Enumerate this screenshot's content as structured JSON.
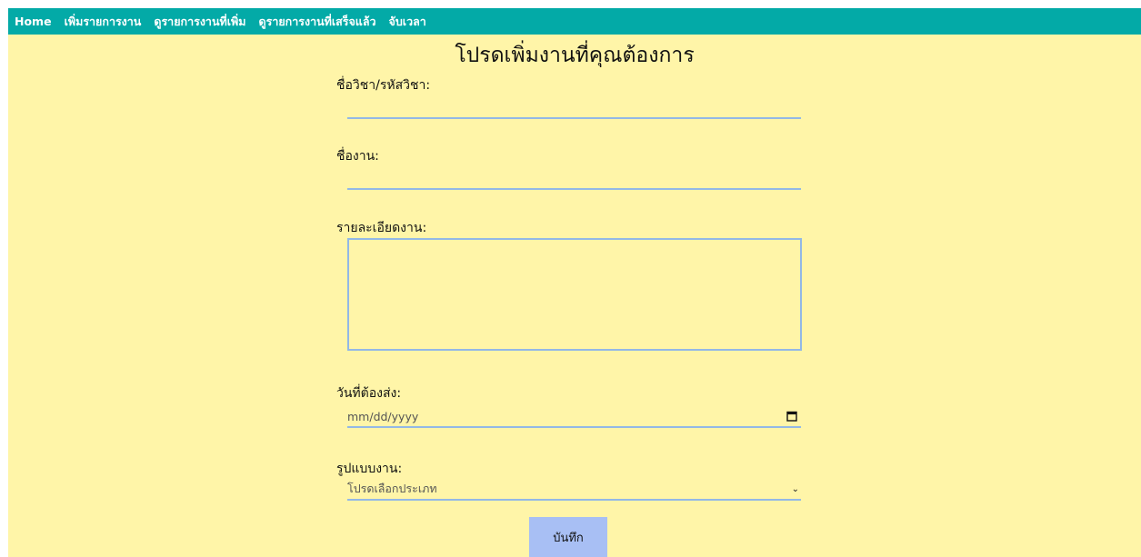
{
  "nav": {
    "items": [
      {
        "label": "Home"
      },
      {
        "label": "เพิ่มรายการงาน"
      },
      {
        "label": "ดูรายการงานที่เพิ่ม"
      },
      {
        "label": "ดูรายการงานที่เสร็จแล้ว"
      },
      {
        "label": "จับเวลา"
      }
    ]
  },
  "form": {
    "title": "โปรดเพิ่มงานที่คุณต้องการ",
    "subject_label": "ชื่อวิชา/รหัสวิชา:",
    "subject_value": "",
    "task_name_label": "ชื่องาน:",
    "task_name_value": "",
    "details_label": "รายละเอียดงาน:",
    "details_value": "",
    "due_date_label": "วันที่ต้องส่ง:",
    "due_date_placeholder": "mm/dd/yyyy",
    "type_label": "รูปแบบงาน:",
    "type_selected": "โปรดเลือกประเภท",
    "save_label": "บันทึก"
  },
  "colors": {
    "nav_bg": "#03aaa7",
    "page_bg": "#fff5a8",
    "input_border": "#93b8e6",
    "button_bg": "#a8bff4"
  }
}
